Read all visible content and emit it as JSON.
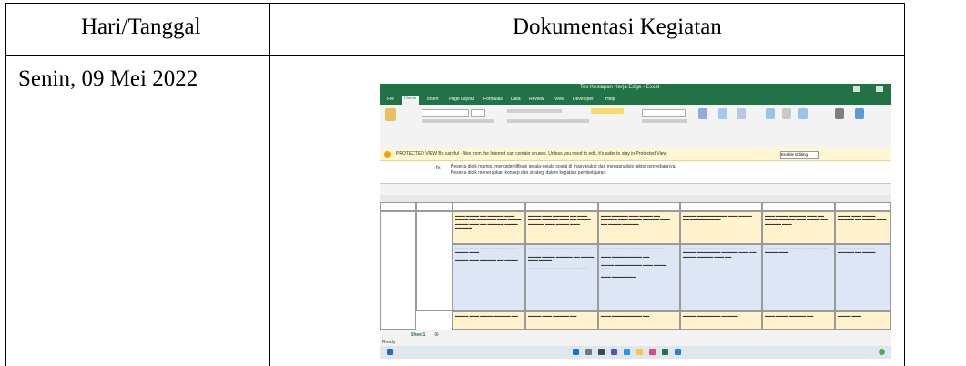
{
  "table": {
    "header_left": "Hari/Tanggal",
    "header_right": "Dokumentasi Kegiatan",
    "row1_date": "Senin, 09 Mei 2022"
  },
  "screenshot": {
    "window_title": "Tes Kesiapan Kerja Edge - Excel",
    "ribbon_tabs": [
      "File",
      "Home",
      "Insert",
      "Page Layout",
      "Formulas",
      "Data",
      "Review",
      "View",
      "Developer",
      "Help"
    ],
    "warning_text": "PROTECTED VIEW Be careful - files from the Internet can contain viruses. Unless you need to edit, it's safer to stay in Protected View.",
    "warning_button": "Enable Editing",
    "formula_text_line1": "Peserta didik mampu mengidentifikasi gejala-gejala sosial di masyarakat dan menganalisis faktor penyebabnya.",
    "formula_text_line2": "Peserta didik menerapkan konsep dan strategi dalam kegiatan pembelajaran.",
    "sheet_tab": "Sheet1",
    "status_text": "Ready",
    "colors": {
      "excel_green": "#217346",
      "cell_yellow": "#fff2cc",
      "cell_blue": "#dce6f4",
      "warning_bar": "#fff7d1"
    }
  }
}
